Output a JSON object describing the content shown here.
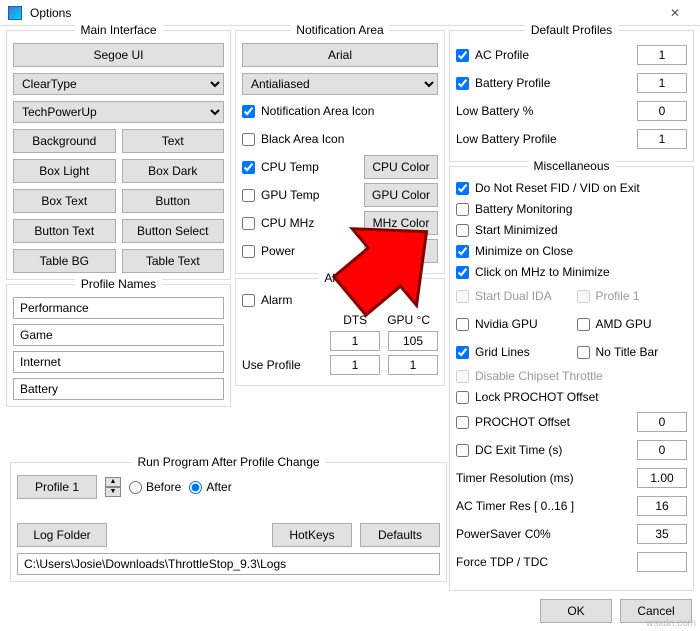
{
  "window": {
    "title": "Options",
    "close": "✕"
  },
  "mainInterface": {
    "legend": "Main Interface",
    "fontBtn": "Segoe UI",
    "renderSel": "ClearType",
    "themeSel": "TechPowerUp",
    "btns": [
      "Background",
      "Text",
      "Box Light",
      "Box Dark",
      "Box Text",
      "Button",
      "Button Text",
      "Button Select",
      "Table BG",
      "Table Text"
    ]
  },
  "profileNames": {
    "legend": "Profile Names",
    "items": [
      "Performance",
      "Game",
      "Internet",
      "Battery"
    ]
  },
  "runProgram": {
    "legend": "Run Program After Profile Change",
    "profileBtn": "Profile 1",
    "before": "Before",
    "after": "After",
    "logFolder": "Log Folder",
    "hotkeys": "HotKeys",
    "defaults": "Defaults",
    "path": "C:\\Users\\Josie\\Downloads\\ThrottleStop_9.3\\Logs"
  },
  "notification": {
    "legend": "Notification Area",
    "fontBtn": "Arial",
    "renderSel": "Antialiased",
    "rows": [
      {
        "chk": true,
        "label": "Notification Area Icon",
        "btn": null
      },
      {
        "chk": false,
        "label": "Black Area Icon",
        "btn": null
      },
      {
        "chk": true,
        "label": "CPU Temp",
        "btn": "CPU Color"
      },
      {
        "chk": false,
        "label": "GPU Temp",
        "btn": "GPU Color"
      },
      {
        "chk": false,
        "label": "CPU MHz",
        "btn": "MHz Color"
      },
      {
        "chk": false,
        "label": "Power",
        "btn": "P Color"
      }
    ]
  },
  "alarm": {
    "legend": "Alarm",
    "alarmLabel": "Alarm",
    "dts": "DTS",
    "gpu": "GPU °C",
    "dtsVal": "1",
    "gpuVal": "105",
    "useProfile": "Use Profile",
    "up1": "1",
    "up2": "1"
  },
  "defaultProfiles": {
    "legend": "Default Profiles",
    "rows": [
      {
        "chk": true,
        "label": "AC Profile",
        "val": "1"
      },
      {
        "chk": true,
        "label": "Battery Profile",
        "val": "1"
      },
      {
        "chk": null,
        "label": "Low Battery %",
        "val": "0"
      },
      {
        "chk": null,
        "label": "Low Battery Profile",
        "val": "1"
      }
    ]
  },
  "misc": {
    "legend": "Miscellaneous",
    "items": [
      {
        "c": true,
        "l": "Do Not Reset FID / VID on Exit"
      },
      {
        "c": false,
        "l": "Battery Monitoring"
      },
      {
        "c": false,
        "l": "Start Minimized"
      },
      {
        "c": true,
        "l": "Minimize on Close"
      },
      {
        "c": true,
        "l": "Click on MHz to Minimize"
      }
    ],
    "dual": [
      {
        "c": false,
        "l": "Start Dual IDA",
        "d": true
      },
      {
        "c": false,
        "l": "Profile 1",
        "d": true
      },
      {
        "c": false,
        "l": "Nvidia GPU"
      },
      {
        "c": false,
        "l": "AMD GPU"
      },
      {
        "c": true,
        "l": "Grid Lines"
      },
      {
        "c": false,
        "l": "No Title Bar"
      }
    ],
    "disableChipset": {
      "c": false,
      "l": "Disable Chipset Throttle",
      "d": true
    },
    "lockProchot": {
      "c": false,
      "l": "Lock PROCHOT Offset"
    },
    "numRows": [
      {
        "chk": false,
        "label": "PROCHOT Offset",
        "val": "0"
      },
      {
        "chk": false,
        "label": "DC Exit Time (s)",
        "val": "0"
      },
      {
        "chk": null,
        "label": "Timer Resolution (ms)",
        "val": "1.00"
      },
      {
        "chk": null,
        "label": "AC Timer Res [ 0..16 ]",
        "val": "16"
      },
      {
        "chk": null,
        "label": "PowerSaver C0%",
        "val": "35"
      },
      {
        "chk": null,
        "label": "Force TDP / TDC",
        "val": ""
      }
    ]
  },
  "footer": {
    "ok": "OK",
    "cancel": "Cancel"
  },
  "watermark": "wsxdn.com"
}
